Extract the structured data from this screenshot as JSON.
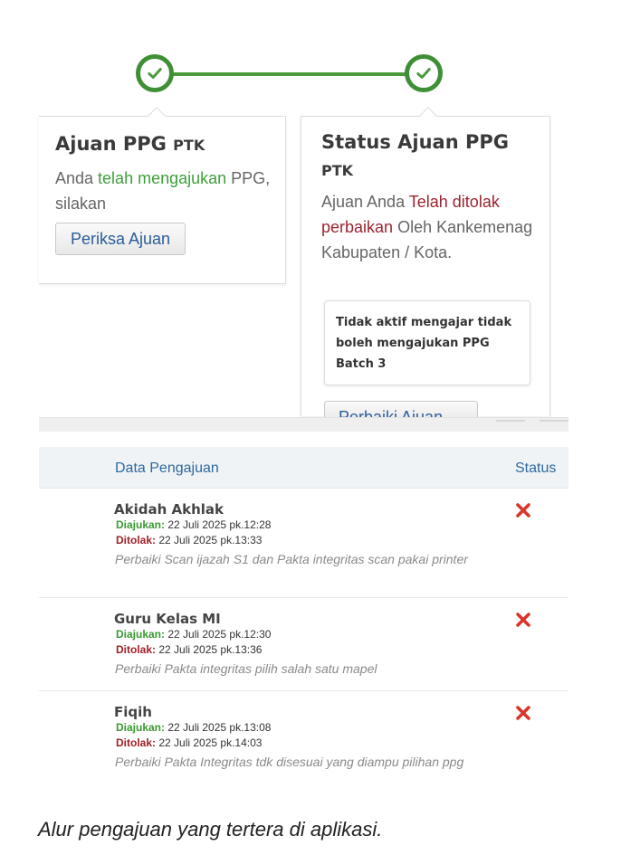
{
  "stepper": {
    "steps": [
      {
        "name": "step-ajuan",
        "done": true
      },
      {
        "name": "step-status",
        "done": true
      }
    ],
    "colors": {
      "line": "#4a9a3c",
      "circle": "#3f8f36"
    }
  },
  "card_ajuan": {
    "title": "Ajuan PPG",
    "title_small": "PTK",
    "body_prefix": "Anda ",
    "body_highlight": "telah mengajukan",
    "body_suffix": " PPG, silakan",
    "button_label": "Periksa Ajuan"
  },
  "card_status": {
    "title": "Status Ajuan PPG",
    "subtitle": "PTK",
    "body_prefix": "Ajuan Anda ",
    "body_highlight": "Telah ditolak perbaikan",
    "body_suffix": " Oleh Kankemenag Kabupaten / Kota.",
    "note": "Tidak aktif mengajar tidak boleh mengajukan PPG Batch 3",
    "button_label": "Perbaiki Ajuan"
  },
  "table": {
    "header_data": "Data Pengajuan",
    "header_status": "Status",
    "label_submitted": "Diajukan:",
    "label_rejected": "Ditolak:",
    "rows": [
      {
        "subject": "Akidah Akhlak",
        "submitted": "22 Juli 2025 pk.12:28",
        "rejected": "22 Juli 2025 pk.13:33",
        "note": "Perbaiki Scan ijazah S1 dan Pakta integritas scan pakai printer",
        "status_icon": "rejected-x-icon"
      },
      {
        "subject": "Guru Kelas MI",
        "submitted": "22 Juli 2025 pk.12:30",
        "rejected": "22 Juli 2025 pk.13:36",
        "note": "Perbaiki Pakta integritas pilih salah satu mapel",
        "status_icon": "rejected-x-icon"
      },
      {
        "subject": "Fiqih",
        "submitted": "22 Juli 2025 pk.13:08",
        "rejected": "22 Juli 2025 pk.14:03",
        "note": "Perbaiki Pakta Integritas tdk disesuai yang diampu pilihan ppg",
        "status_icon": "rejected-x-icon"
      }
    ],
    "colors": {
      "header_text": "#2c6aa0",
      "submitted": "#3a9a30",
      "rejected": "#a02028",
      "status_x": "#d9362b"
    }
  },
  "caption": "Alur pengajuan yang tertera di aplikasi."
}
